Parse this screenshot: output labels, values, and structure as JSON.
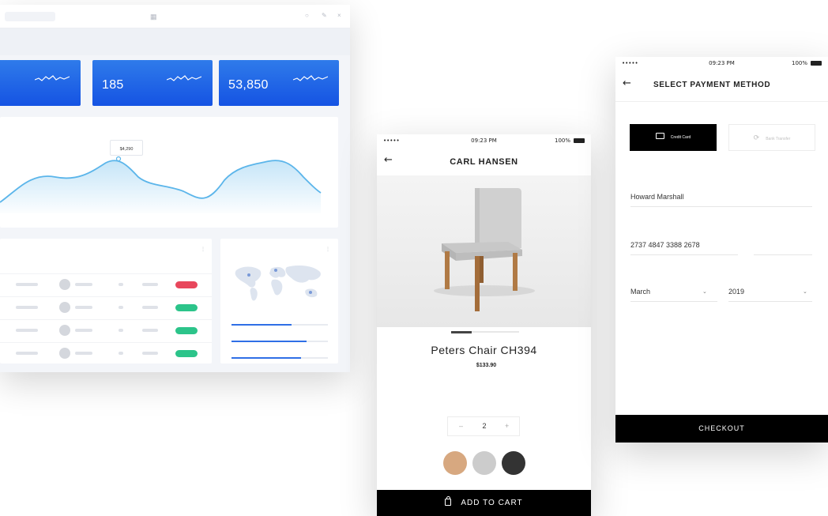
{
  "dashboard": {
    "kpis": [
      {
        "value": ""
      },
      {
        "value": "185"
      },
      {
        "value": "53,850"
      }
    ],
    "chart_tooltip": "$4,290",
    "table": {
      "badges": [
        {
          "color": "#e8475c"
        },
        {
          "color": "#2cc48a"
        },
        {
          "color": "#2cc48a"
        },
        {
          "color": "#2cc48a"
        }
      ]
    },
    "sales_by_location": [
      {
        "fill": 0.62
      },
      {
        "fill": 0.78
      },
      {
        "fill": 0.72
      }
    ]
  },
  "product_screen": {
    "status": {
      "signal": "•••••",
      "time": "09:23 PM",
      "battery": "100%"
    },
    "back_icon": "arrow-left-icon",
    "title": "CARL HANSEN",
    "product_name": "Peters Chair CH394",
    "new_price": "$133.90",
    "pager": {
      "current": 1,
      "total": 3
    },
    "quantity": {
      "minus": "–",
      "value": "2",
      "plus": "+"
    },
    "swatches": [
      "#d7a880",
      "#cccccc",
      "#333333"
    ],
    "cta_label": "ADD TO CART",
    "cta_icon": "shopping-bag-icon"
  },
  "payment_screen": {
    "status": {
      "signal": "•••••",
      "time": "09:23 PM",
      "battery": "100%"
    },
    "back_icon": "arrow-left-icon",
    "title": "SELECT PAYMENT METHOD",
    "methods": [
      {
        "label": "Credit Card",
        "icon": "credit-card-icon",
        "active": true
      },
      {
        "label": "Bank Transfer",
        "icon": "sync-icon",
        "active": false
      }
    ],
    "name_on_card": {
      "value": "Howard Marshall"
    },
    "card_number": {
      "value": "2737 4847 3388 2678"
    },
    "month": {
      "value": "March"
    },
    "year": {
      "value": "2019"
    },
    "cta_label": "CHECKOUT"
  }
}
